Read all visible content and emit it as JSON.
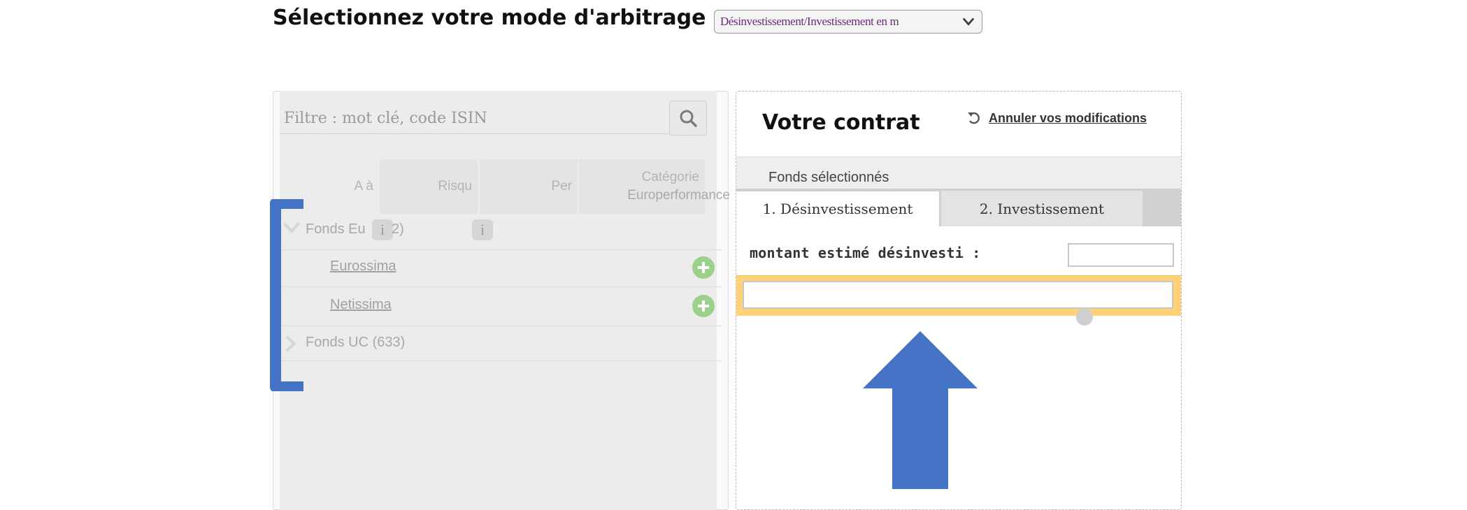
{
  "header": {
    "title": "Sélectionnez votre mode d'arbitrage :",
    "mode_select_value": "Désinvestissement/Investissement en m"
  },
  "left_panel": {
    "filter_placeholder": "Filtre : mot clé, code ISIN",
    "columns": {
      "az": "A à",
      "risk": "Risqu",
      "perf": "Per",
      "category_line1": "Catégorie",
      "category_line2": "Europerformance"
    },
    "groups": [
      {
        "label": "Fonds Eu",
        "count": "2)",
        "info_glyph": "i",
        "funds": [
          {
            "label": "Eurossima"
          },
          {
            "label": "Netissima"
          }
        ]
      },
      {
        "label": "Fonds UC (633)"
      }
    ]
  },
  "right_panel": {
    "title": "Votre contrat",
    "undo_label": "Annuler vos modifications",
    "selected_funds_label": "Fonds sélectionnés",
    "tabs": [
      {
        "label": "1. Désinvestissement",
        "active": true
      },
      {
        "label": "2. Investissement",
        "active": false
      }
    ],
    "amount_label": "montant estimé désinvesti :",
    "amount_value": ""
  },
  "colors": {
    "annotation_blue": "#4472c4",
    "highlight_yellow": "#ffd277",
    "add_green": "#9bd18a",
    "select_text": "#6b2b78"
  }
}
